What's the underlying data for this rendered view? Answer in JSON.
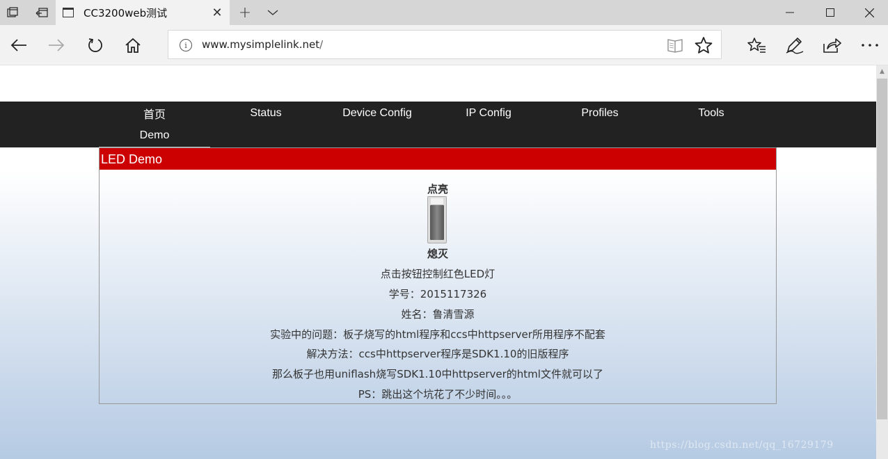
{
  "browser": {
    "tab_title": "CC3200web测试",
    "url_host": "www.mysimplelink.net",
    "url_path": "/"
  },
  "icons": {
    "tab_manager": "tab-manager-icon",
    "set_aside": "set-aside-tabs-icon",
    "back": "back-arrow-icon",
    "forward": "forward-arrow-icon",
    "refresh": "refresh-icon",
    "home": "home-icon",
    "info": "info-icon",
    "reading_view": "reading-view-icon",
    "favorite": "star-icon",
    "hub": "favorites-hub-icon",
    "notes": "pen-icon",
    "share": "share-icon",
    "more": "more-icon"
  },
  "nav": {
    "items": [
      "首页",
      "Status",
      "Device Config",
      "IP Config",
      "Profiles",
      "Tools",
      "Demo"
    ]
  },
  "panel": {
    "title": "LED Demo",
    "switch_on_label": "点亮",
    "switch_off_label": "熄灭",
    "lines": [
      "点击按钮控制红色LED灯",
      "学号：2015117326",
      "姓名：鲁清雪源",
      "实验中的问题：板子烧写的html程序和ccs中httpserver所用程序不配套",
      "解决方法：ccs中httpserver程序是SDK1.10的旧版程序",
      "那么板子也用uniflash烧写SDK1.10中httpserver的html文件就可以了",
      "PS：跳出这个坑花了不少时间。。。"
    ]
  },
  "watermark": "https://blog.csdn.net/qq_16729179",
  "colors": {
    "nav_bg": "#222222",
    "panel_header": "#cc0000",
    "page_gradient_bottom": "#b5cae3"
  }
}
